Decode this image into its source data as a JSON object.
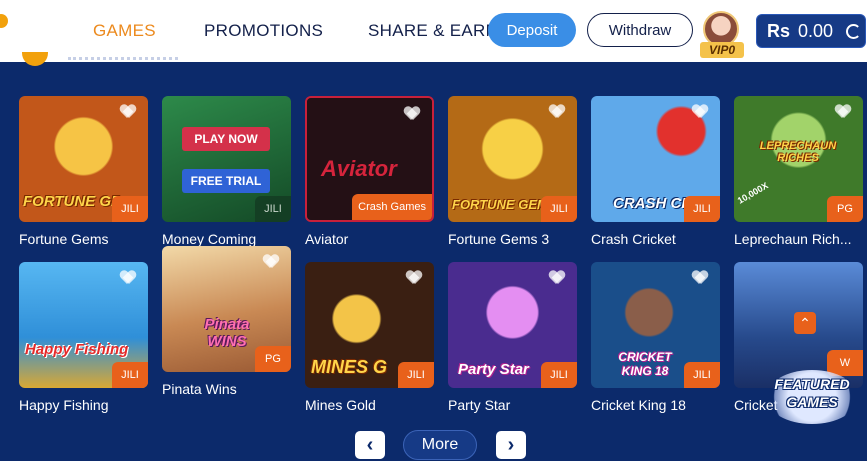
{
  "nav": {
    "items": [
      {
        "label": "GAMES",
        "active": true
      },
      {
        "label": "PROMOTIONS",
        "active": false
      },
      {
        "label": "SHARE & EARN",
        "active": false
      }
    ],
    "deposit_label": "Deposit",
    "withdraw_label": "Withdraw",
    "vip_label": "VIP0",
    "balance_currency": "Rs",
    "balance_value": "0.00"
  },
  "games": [
    {
      "name": "Fortune Gems",
      "art_title": "FORTUNE GE",
      "provider": "JILI",
      "color": "#c2571a"
    },
    {
      "name": "Money Coming",
      "art_title": "",
      "provider": "JILI",
      "color": "#1f6b3a",
      "play_label": "PLAY NOW",
      "trial_label": "FREE TRIAL"
    },
    {
      "name": "Aviator",
      "art_title": "Aviator",
      "provider": "Crash Games",
      "color": "#2b0f16"
    },
    {
      "name": "Fortune Gems 3",
      "art_title": "FORTUNE GEMS",
      "provider": "JILI",
      "color": "#b46a16"
    },
    {
      "name": "Crash Cricket",
      "art_title": "CRASH CRICK",
      "provider": "JILI",
      "color": "#3b86d6"
    },
    {
      "name": "Leprechaun Rich...",
      "art_title": "LEPRECHAUN RICHES",
      "provider": "PG",
      "color": "#3f7a2a",
      "corner_text": "10,000X"
    },
    {
      "name": "Happy Fishing",
      "art_title": "Happy Fishing",
      "provider": "JILI",
      "color": "#2f8fd8"
    },
    {
      "name": "Pinata Wins",
      "art_title": "Pinata WINS",
      "provider": "PG",
      "color": "#d3a36a"
    },
    {
      "name": "Mines Gold",
      "art_title": "MINES G",
      "provider": "JILI",
      "color": "#3a1f12"
    },
    {
      "name": "Party Star",
      "art_title": "Party Star",
      "provider": "JILI",
      "color": "#4a2c8f"
    },
    {
      "name": "Cricket King 18",
      "art_title": "CRICKET KING 18",
      "provider": "JILI",
      "color": "#1a4e8a"
    },
    {
      "name": "Cricket",
      "art_title": "",
      "provider": "W",
      "color": "#274a8c"
    }
  ],
  "pager": {
    "prev": "‹",
    "more": "More",
    "next": "›"
  },
  "featured": {
    "line1": "FEATURED",
    "line2": "GAMES"
  },
  "colors": {
    "accent": "#ec8a1e",
    "background": "#0c2a6b",
    "provider_tag": "#e8611b",
    "deposit": "#3a8ee6"
  }
}
